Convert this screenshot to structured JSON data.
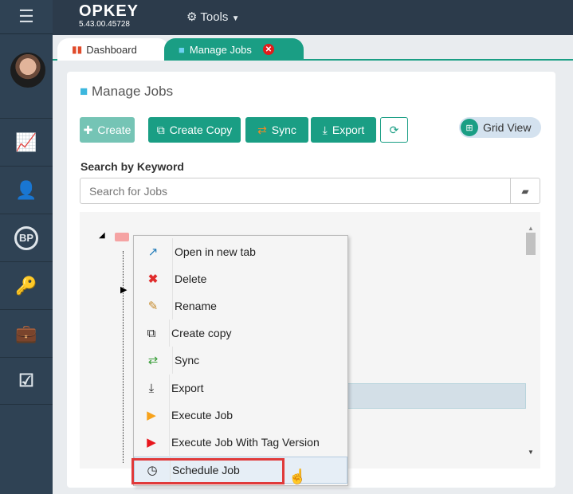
{
  "app": {
    "logo": "OPKEY",
    "version": "5.43.00.45728",
    "tools_label": "Tools"
  },
  "sidebar": {
    "items": [
      "dashboard",
      "job-assign",
      "bp",
      "tc",
      "manage-jobs",
      "reports"
    ]
  },
  "tabs": [
    {
      "label": "Dashboard"
    },
    {
      "label": "Manage Jobs"
    }
  ],
  "panel": {
    "title": "Manage Jobs",
    "buttons": {
      "create": "Create",
      "create_copy": "Create Copy",
      "sync": "Sync",
      "export": "Export"
    },
    "grid_view": "Grid View",
    "search_label": "Search by Keyword",
    "search_placeholder": "Search for Jobs"
  },
  "context_menu": [
    {
      "label": "Open in new tab",
      "icon": "external-link-icon"
    },
    {
      "label": "Delete",
      "icon": "delete-icon"
    },
    {
      "label": "Rename",
      "icon": "rename-icon"
    },
    {
      "label": "Create copy",
      "icon": "copy-icon"
    },
    {
      "label": "Sync",
      "icon": "sync-icon"
    },
    {
      "label": "Export",
      "icon": "export-icon"
    },
    {
      "label": "Execute Job",
      "icon": "play-orange-icon"
    },
    {
      "label": "Execute Job With Tag Version",
      "icon": "play-red-icon"
    },
    {
      "label": "Schedule Job",
      "icon": "clock-icon"
    }
  ],
  "colors": {
    "accent": "#1a9e84",
    "header": "#2c3b4b",
    "highlight": "#e03a3a"
  }
}
